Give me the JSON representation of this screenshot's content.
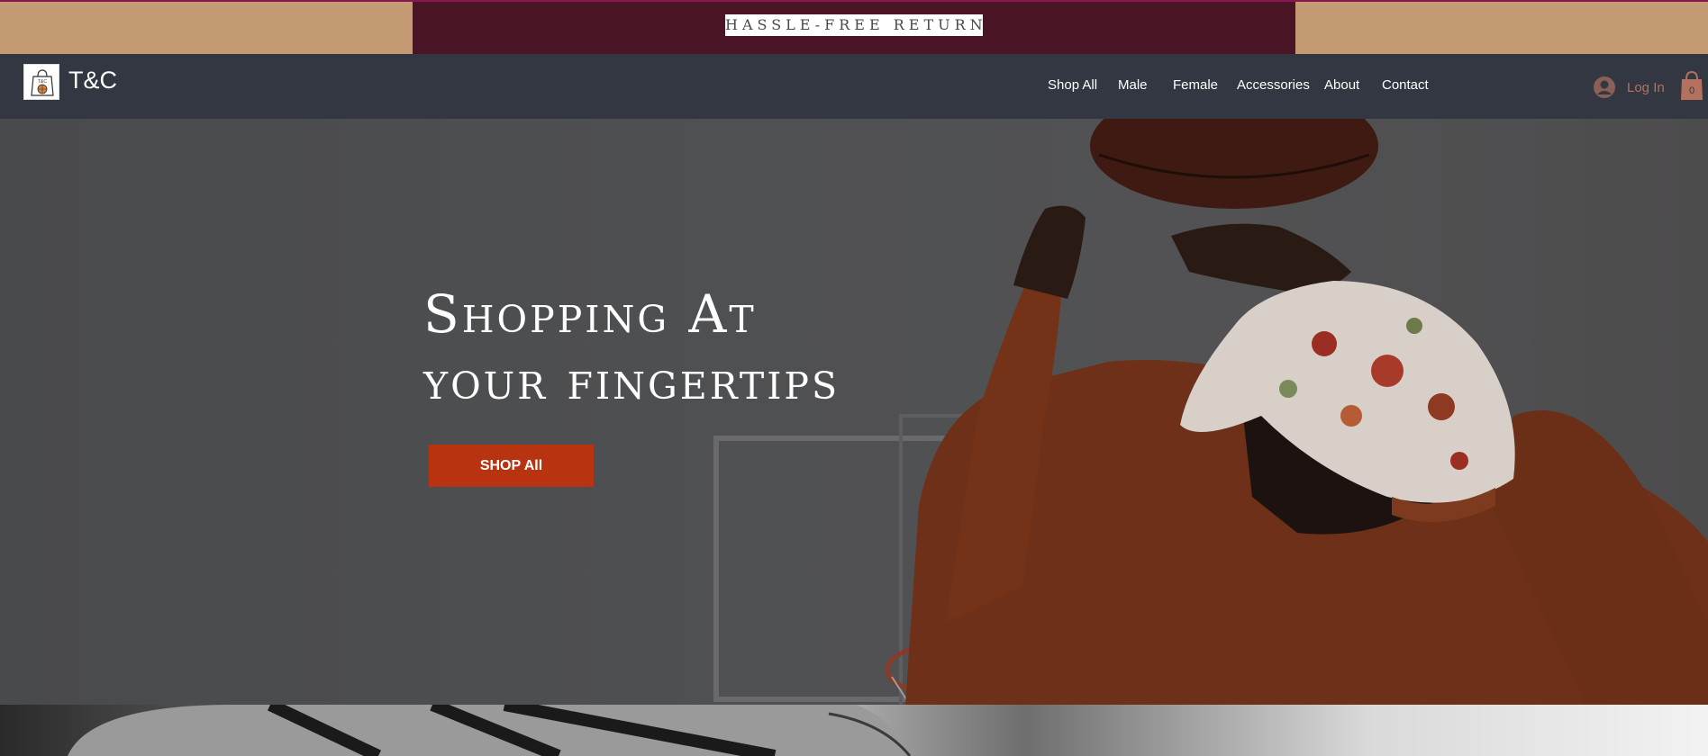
{
  "announcement": {
    "text": "HASSLE-FREE RETURNS"
  },
  "header": {
    "brand": "T&C",
    "logo_text": "T&C",
    "nav": [
      {
        "label": "Shop All"
      },
      {
        "label": "Male"
      },
      {
        "label": "Female"
      },
      {
        "label": "Accessories"
      },
      {
        "label": "About"
      },
      {
        "label": "Contact"
      }
    ],
    "login_label": "Log In",
    "cart_count": "0"
  },
  "hero": {
    "title_line1": "Shopping At",
    "title_line2": "your fingertips",
    "button_label": "SHOP All"
  },
  "icons": {
    "logo": "shopping-bag-basketball-icon",
    "login": "user-avatar-icon",
    "cart": "shopping-bag-icon"
  },
  "colors": {
    "announce_outer": "#c49a73",
    "announce_inner": "#4a1626",
    "header_bg": "#323741",
    "accent": "#b8330f",
    "login_text": "#b3715e"
  }
}
